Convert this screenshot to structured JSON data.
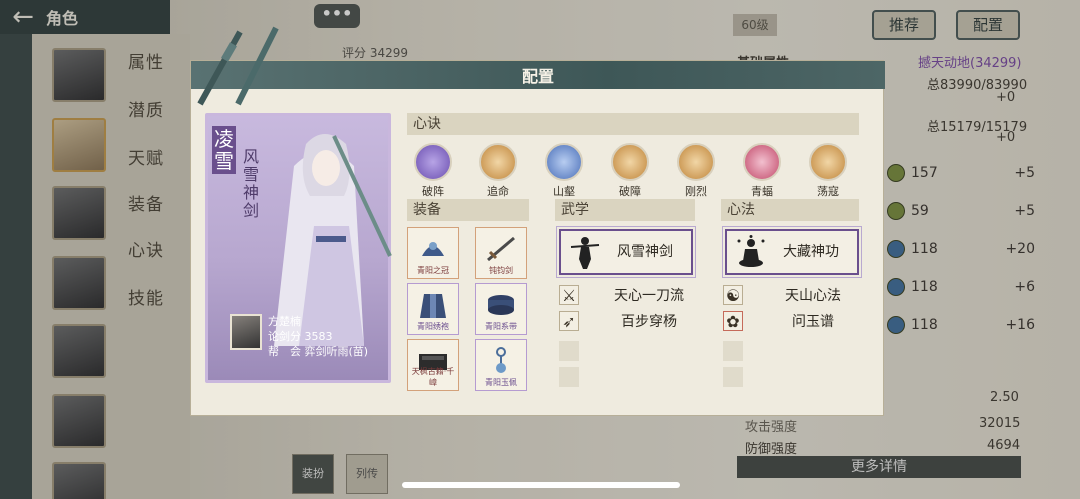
{
  "topbar": {
    "title": "角色"
  },
  "sidebar": {
    "tabs": [
      "属性",
      "潜质",
      "天赋",
      "装备",
      "心诀",
      "技能"
    ]
  },
  "background": {
    "chat": "•••",
    "score_label": "评分",
    "score_value": "34299",
    "level": "60级",
    "recommend_button": "推荐",
    "config_button": "配置",
    "base_attr_label": "基础属性",
    "realm": "撼天动地(34299)",
    "hp": "总83990/83990",
    "hp_add": "+0",
    "mp": "总15179/15179",
    "mp_add": "+0",
    "stats": [
      {
        "value": "157",
        "add": "+5"
      },
      {
        "value": "59",
        "add": "+5"
      },
      {
        "value": "118",
        "add": "+20"
      },
      {
        "value": "118",
        "add": "+6"
      },
      {
        "value": "118",
        "add": "+16"
      }
    ],
    "ratio": "2.50",
    "attack_label": "攻击强度",
    "attack_value": "32015",
    "defense_label": "防御强度",
    "defense_value": "4694",
    "more_details": "更多详情",
    "bottom_tabs": [
      "装扮",
      "列传"
    ]
  },
  "modal": {
    "title": "配置",
    "character": {
      "name": "凌雪",
      "title": "风雪神剑",
      "player": "方楚楠",
      "score_line": "论剑分 3583",
      "guild_line": "帮　会 弈剑听雨(苗)"
    },
    "xinjue": {
      "header": "心诀",
      "items": [
        {
          "label": "破阵",
          "color": "#6b4fb0"
        },
        {
          "label": "追命",
          "color": "#c0853a"
        },
        {
          "label": "山壑",
          "color": "#4a6fb8"
        },
        {
          "label": "破障",
          "color": "#c0853a"
        },
        {
          "label": "刚烈",
          "color": "#c0853a"
        },
        {
          "label": "青蝠",
          "color": "#c24a6a"
        },
        {
          "label": "荡寇",
          "color": "#c0853a"
        }
      ]
    },
    "equipment": {
      "header": "装备",
      "items": [
        "青阳之冠",
        "钝钧剑",
        "青阳绣袍",
        "青阳系带",
        "天枫古籍·千嶂",
        "青阳玉佩"
      ]
    },
    "wuxue": {
      "header": "武学",
      "main": "风雪神剑",
      "subs": [
        "天心一刀流",
        "百步穿杨"
      ]
    },
    "xinfa": {
      "header": "心法",
      "main": "大藏神功",
      "subs": [
        "天山心法",
        "问玉谱"
      ]
    }
  }
}
